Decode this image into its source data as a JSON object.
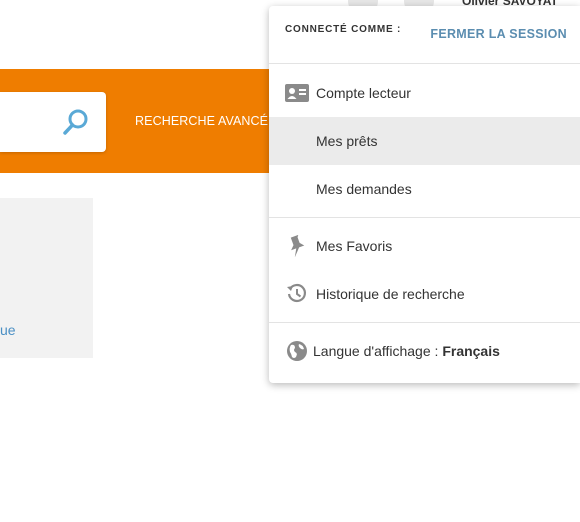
{
  "header": {
    "user_name": "Olivier SAVOYAT"
  },
  "search": {
    "advanced_label": "RECHERCHE AVANCÉE"
  },
  "side_card": {
    "link_fragment": "ue"
  },
  "account_menu": {
    "connected_label": "CONNECTÉ COMME :",
    "logout_label": "FERMER LA SESSION",
    "items": [
      {
        "label": "Compte lecteur",
        "icon": "id-card-icon"
      },
      {
        "label": "Mes prêts",
        "icon": null,
        "active": true
      },
      {
        "label": "Mes demandes",
        "icon": null
      },
      {
        "label": "Mes Favoris",
        "icon": "pin-icon"
      },
      {
        "label": "Historique de recherche",
        "icon": "history-icon"
      }
    ],
    "language": {
      "label": "Langue d'affichage :",
      "value": "Français",
      "icon": "globe-icon"
    }
  },
  "colors": {
    "brand_orange": "#ef7d00",
    "link_blue": "#5b8db0",
    "active_row": "#ebebeb",
    "icon_grey": "#8a8a8a"
  }
}
